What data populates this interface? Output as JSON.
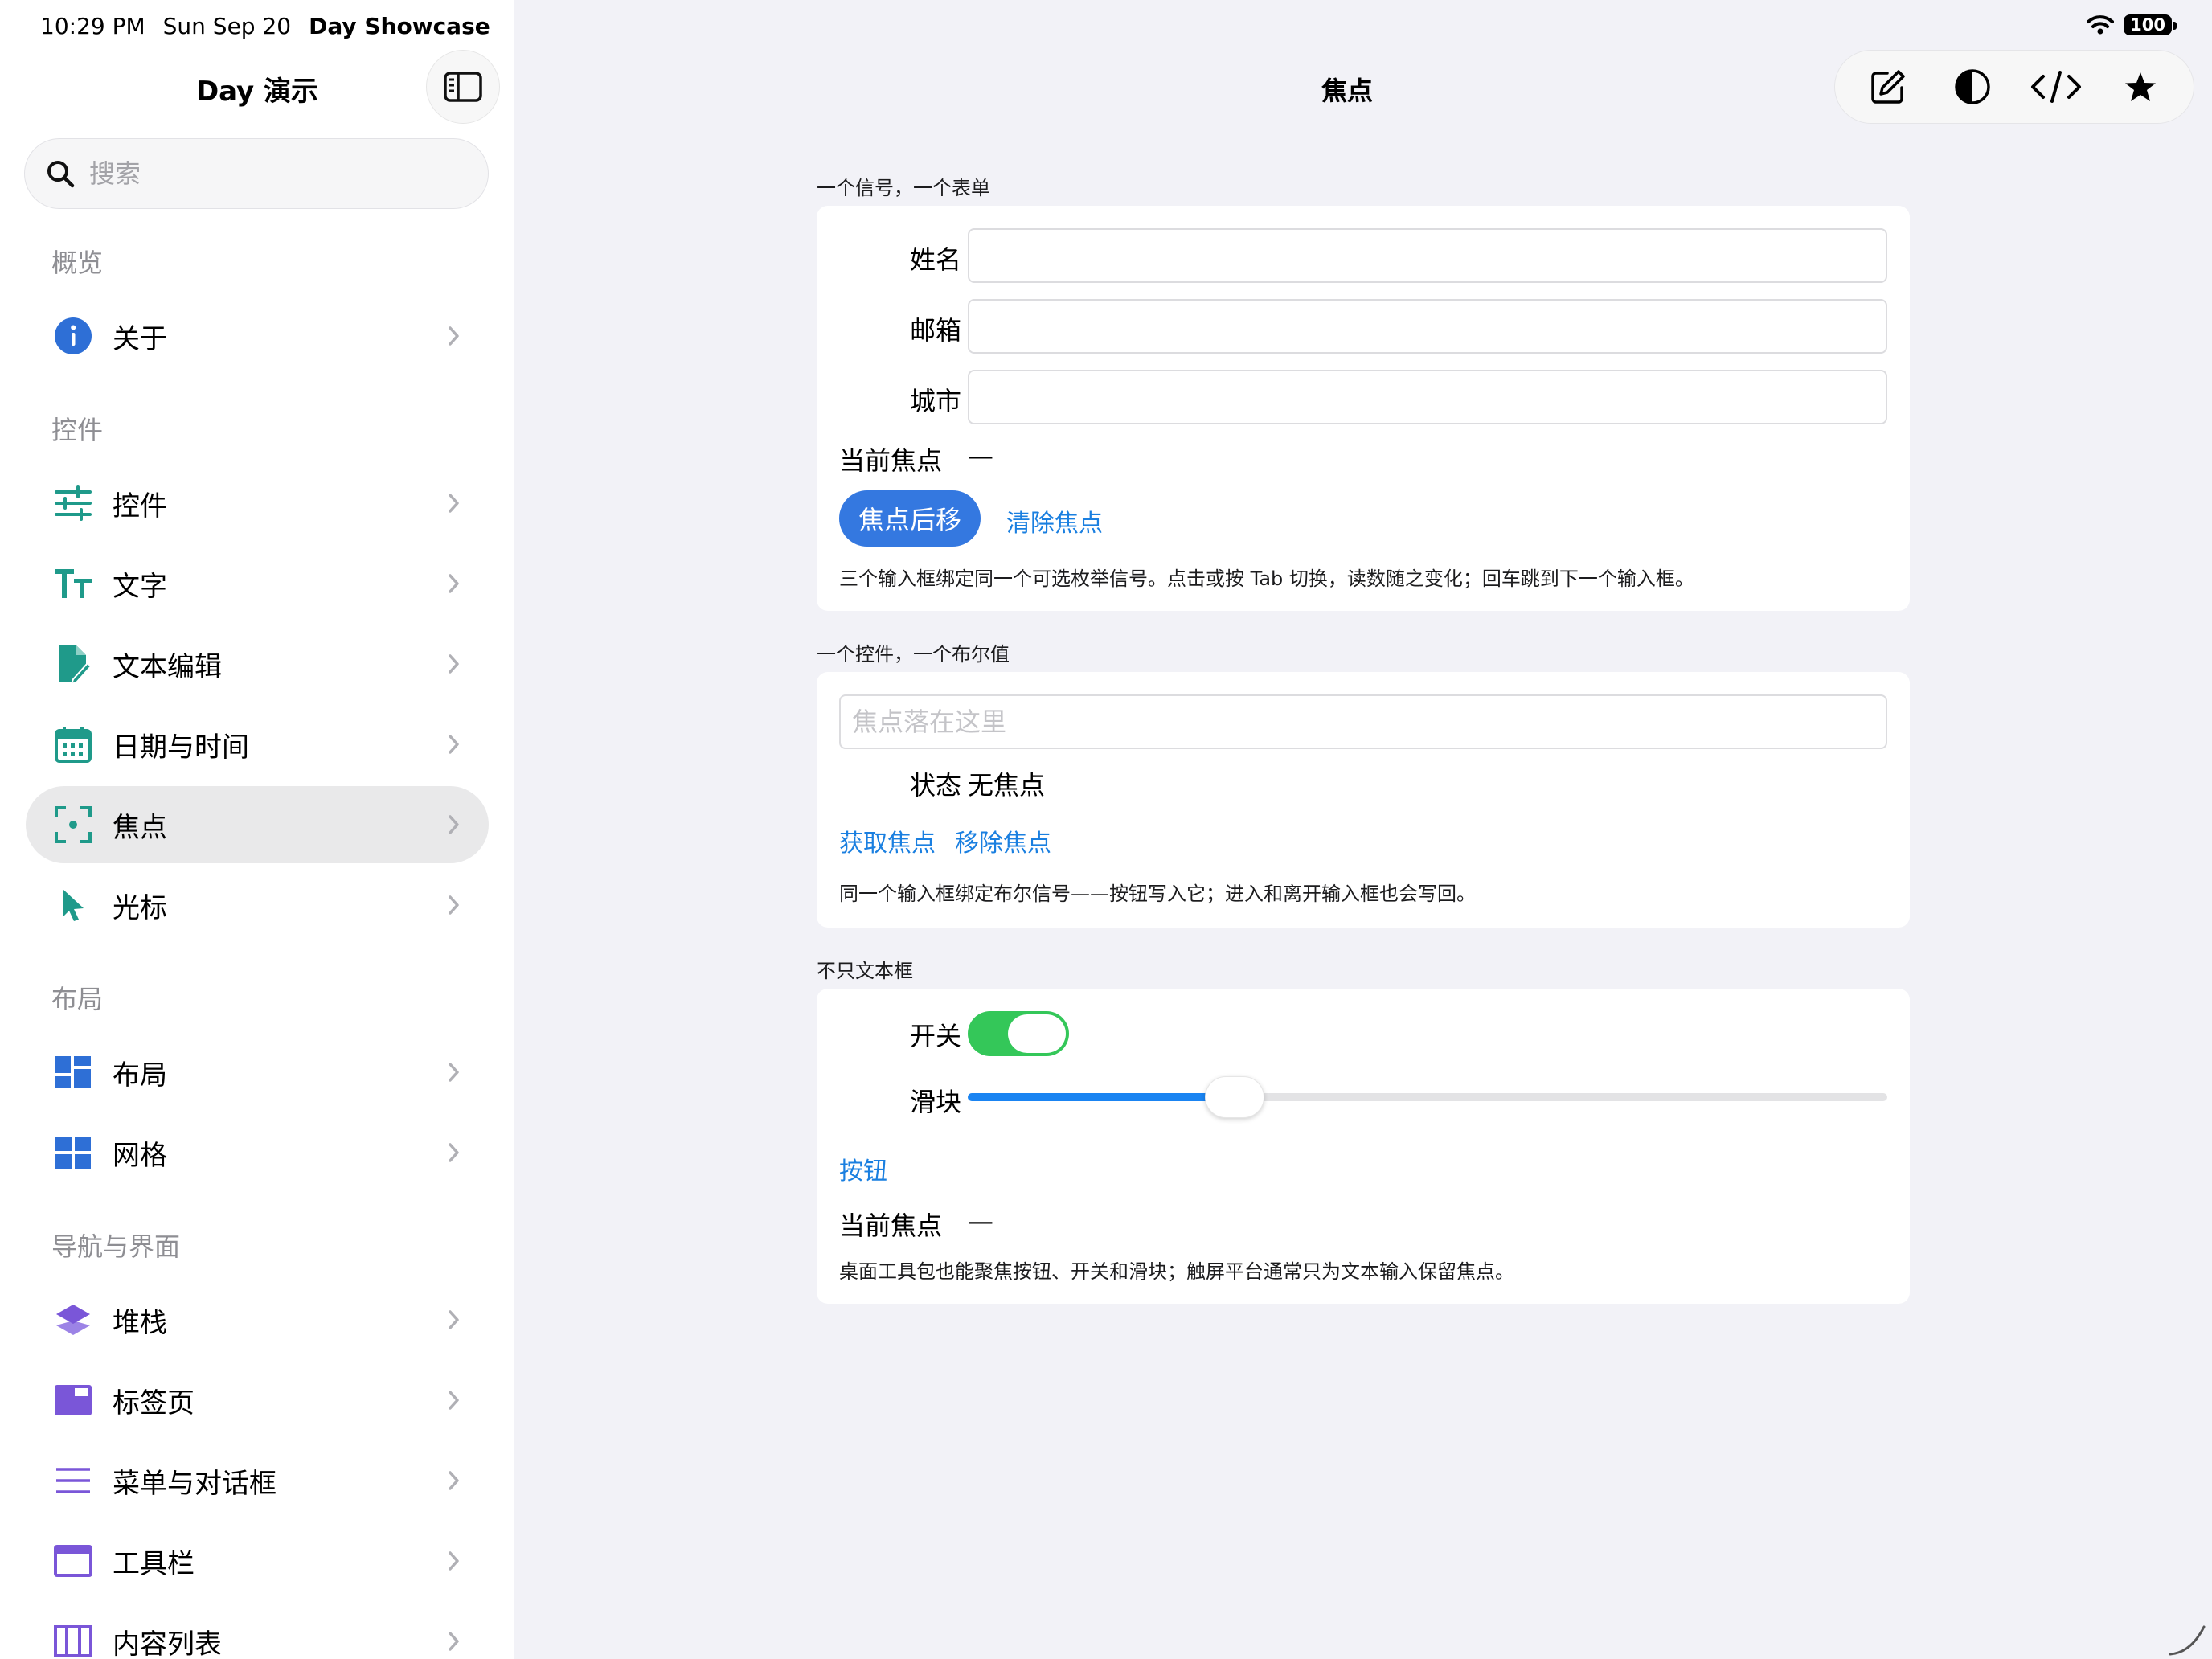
{
  "status_bar": {
    "time": "10:29 PM",
    "date": "Sun Sep 20",
    "app_name": "Day Showcase",
    "battery": "100"
  },
  "sidebar": {
    "title": "Day 演示",
    "search_placeholder": "搜索",
    "sections": [
      {
        "label": "概览",
        "items": [
          {
            "label": "关于",
            "icon": "info-icon"
          }
        ]
      },
      {
        "label": "控件",
        "items": [
          {
            "label": "控件",
            "icon": "sliders-icon"
          },
          {
            "label": "文字",
            "icon": "text-size-icon"
          },
          {
            "label": "文本编辑",
            "icon": "document-edit-icon"
          },
          {
            "label": "日期与时间",
            "icon": "calendar-icon"
          },
          {
            "label": "焦点",
            "icon": "focus-icon",
            "selected": true
          },
          {
            "label": "光标",
            "icon": "cursor-icon"
          }
        ]
      },
      {
        "label": "布局",
        "items": [
          {
            "label": "布局",
            "icon": "layout-icon"
          },
          {
            "label": "网格",
            "icon": "grid-icon"
          }
        ]
      },
      {
        "label": "导航与界面",
        "items": [
          {
            "label": "堆栈",
            "icon": "stack-icon"
          },
          {
            "label": "标签页",
            "icon": "tabs-icon"
          },
          {
            "label": "菜单与对话框",
            "icon": "menu-icon"
          },
          {
            "label": "工具栏",
            "icon": "toolbar-icon"
          },
          {
            "label": "内容列表",
            "icon": "content-list-icon"
          }
        ]
      }
    ]
  },
  "main": {
    "title": "焦点",
    "toolbar": [
      "compose-icon",
      "contrast-icon",
      "code-icon",
      "star-icon"
    ],
    "group1": {
      "header": "一个信号，一个表单",
      "fields": [
        {
          "label": "姓名",
          "value": ""
        },
        {
          "label": "邮箱",
          "value": ""
        },
        {
          "label": "城市",
          "value": ""
        }
      ],
      "current_focus_label": "当前焦点",
      "current_focus_value": "—",
      "advance_button": "焦点后移",
      "clear_button": "清除焦点",
      "description": "三个输入框绑定同一个可选枚举信号。点击或按 Tab 切换，读数随之变化；回车跳到下一个输入框。"
    },
    "group2": {
      "header": "一个控件，一个布尔值",
      "field_placeholder": "焦点落在这里",
      "state_label": "状态",
      "state_value": "无焦点",
      "focus_button": "获取焦点",
      "unfocus_button": "移除焦点",
      "description": "同一个输入框绑定布尔信号——按钮写入它；进入和离开输入框也会写回。"
    },
    "group3": {
      "header": "不只文本框",
      "switch_label": "开关",
      "switch_on": true,
      "slider_label": "滑块",
      "slider_value": 0.29,
      "button_label": "按钮",
      "current_focus_label": "当前焦点",
      "current_focus_value": "—",
      "description": "桌面工具包也能聚焦按钮、开关和滑块；触屏平台通常只为文本输入保留焦点。"
    }
  },
  "colors": {
    "accent": "#3478e0",
    "link": "#1a7fe0",
    "switch_on": "#34c759",
    "slider_fill": "#1a84f2",
    "background": "#f2f2f7"
  }
}
